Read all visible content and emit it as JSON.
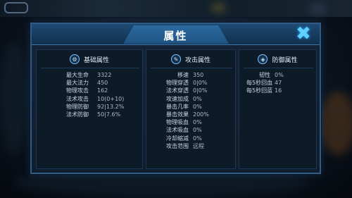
{
  "dialog": {
    "title": "属性",
    "close_label": "✖"
  },
  "columns": [
    {
      "title": "基础属性",
      "icon": "gear-icon",
      "rows": [
        {
          "label": "最大生命",
          "value": "3322"
        },
        {
          "label": "最大法力",
          "value": "450"
        },
        {
          "label": "物理攻击",
          "value": "162"
        },
        {
          "label": "法术攻击",
          "value": "10(0+10)"
        },
        {
          "label": "物理防御",
          "value": "92|13.2%"
        },
        {
          "label": "法术防御",
          "value": "50|7.6%"
        }
      ]
    },
    {
      "title": "攻击属性",
      "icon": "sword-icon",
      "rows": [
        {
          "label": "移速",
          "value": "350"
        },
        {
          "label": "物理穿透",
          "value": "0|0%"
        },
        {
          "label": "法术穿透",
          "value": "0|0%"
        },
        {
          "label": "攻速加成",
          "value": "0%"
        },
        {
          "label": "暴击几率",
          "value": "0%"
        },
        {
          "label": "暴击效果",
          "value": "200%"
        },
        {
          "label": "物理吸血",
          "value": "0%"
        },
        {
          "label": "法术吸血",
          "value": "0%"
        },
        {
          "label": "冷却缩减",
          "value": "0%"
        },
        {
          "label": "攻击范围",
          "value": "远程"
        }
      ]
    },
    {
      "title": "防御属性",
      "icon": "shield-icon",
      "rows": [
        {
          "label": "韧性",
          "value": "0%"
        },
        {
          "label": "每5秒回血",
          "value": "47"
        },
        {
          "label": "每5秒回蓝",
          "value": "16"
        }
      ]
    }
  ]
}
